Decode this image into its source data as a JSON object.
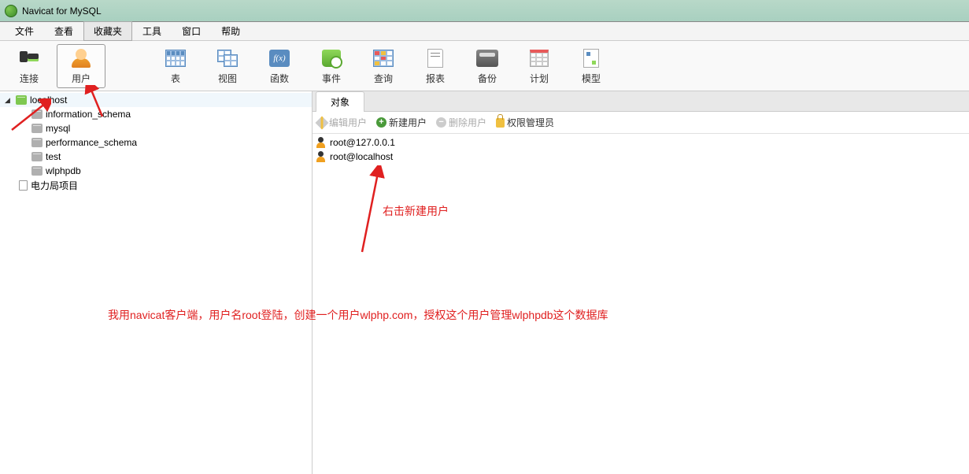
{
  "app": {
    "title": "Navicat for MySQL"
  },
  "menu": {
    "file": "文件",
    "view": "查看",
    "favorites": "收藏夹",
    "tools": "工具",
    "window": "窗口",
    "help": "帮助"
  },
  "toolbar": {
    "connect": "连接",
    "user": "用户",
    "table": "表",
    "view": "视图",
    "function": "函数",
    "event": "事件",
    "query": "查询",
    "report": "报表",
    "backup": "备份",
    "schedule": "计划",
    "model": "模型",
    "func_text": "f(x)"
  },
  "tree": {
    "root": "localhost",
    "dbs": [
      "information_schema",
      "mysql",
      "performance_schema",
      "test",
      "wlphpdb"
    ],
    "folder": "电力局项目"
  },
  "content": {
    "tab": "对象",
    "actions": {
      "edit": "编辑用户",
      "new": "新建用户",
      "delete": "删除用户",
      "privilege": "权限管理员"
    },
    "users": [
      "root@127.0.0.1",
      "root@localhost"
    ]
  },
  "annotations": {
    "a1": "右击新建用户",
    "a2": "我用navicat客户端，用户名root登陆，创建一个用户wlphp.com，授权这个用户管理wlphpdb这个数据库"
  }
}
